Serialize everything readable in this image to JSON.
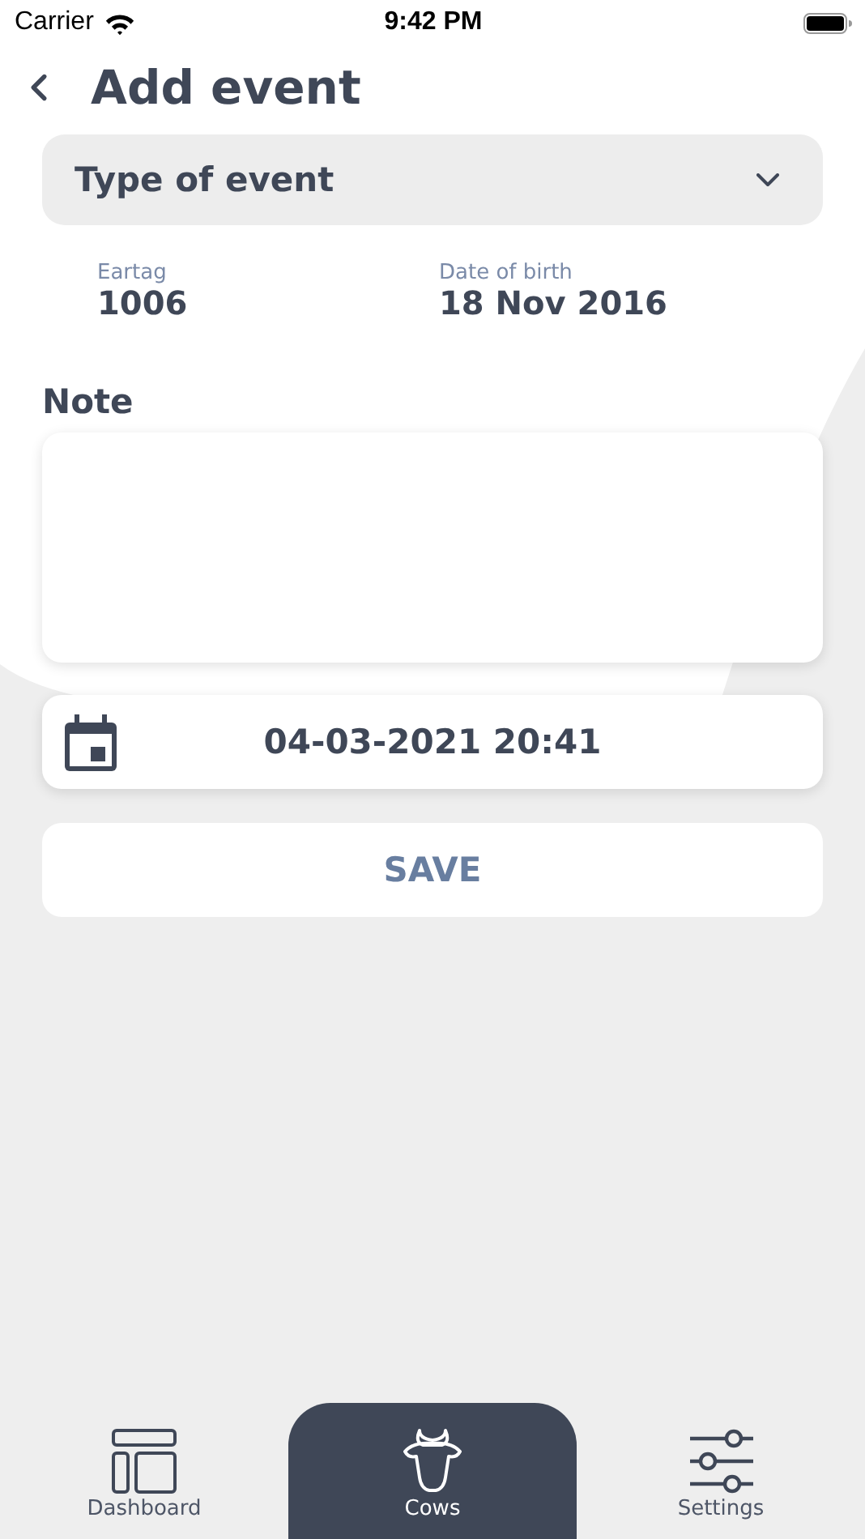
{
  "status_bar": {
    "carrier": "Carrier",
    "time": "9:42 PM"
  },
  "header": {
    "title": "Add event"
  },
  "event_type": {
    "placeholder": "Type of event"
  },
  "info": [
    {
      "label": "Eartag",
      "value": "1006"
    },
    {
      "label": "Date of birth",
      "value": "18 Nov 2016"
    }
  ],
  "note": {
    "label": "Note"
  },
  "date_field": {
    "value": "04-03-2021 20:41"
  },
  "save_button": {
    "label": "SAVE"
  },
  "tabs": [
    {
      "label": "Dashboard",
      "kind": "dashboard",
      "selected": false
    },
    {
      "label": "Cows",
      "kind": "cow",
      "selected": true
    },
    {
      "label": "Settings",
      "kind": "settings",
      "selected": false
    }
  ]
}
